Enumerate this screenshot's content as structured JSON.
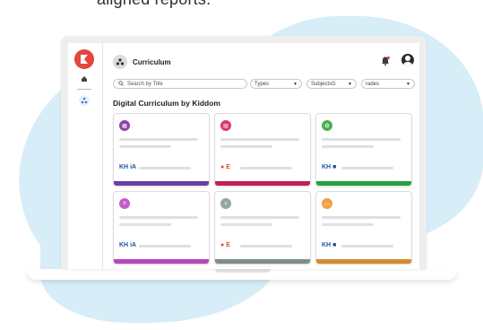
{
  "marketing": {
    "top_text": "aligned reports."
  },
  "app": {
    "header_title": "Curriculum",
    "section_title": "Digital Curriculum by Kiddom"
  },
  "search": {
    "placeholder": "Search by Title"
  },
  "filters": [
    {
      "label": "Types"
    },
    {
      "label": "SubjectsG"
    },
    {
      "label": "rades"
    }
  ],
  "cards": [
    {
      "accent": "#6a3fa8",
      "icon_bg": "#8e44ad",
      "icon_name": "calculator-icon",
      "brand": "KH",
      "brand_mark": "iA",
      "brand_color": "#1f4fa3"
    },
    {
      "accent": "#c0205a",
      "icon_bg": "#d63a6b",
      "icon_name": "book-icon",
      "brand": "●",
      "brand_mark": "E",
      "brand_color": "#e0472b"
    },
    {
      "accent": "#27a043",
      "icon_bg": "#4caf50",
      "icon_name": "science-icon",
      "brand": "KH",
      "brand_mark": "■",
      "brand_color": "#1f4fa3"
    },
    {
      "accent": "#b646b9",
      "icon_bg": "#c65bc8",
      "icon_name": "math-icon",
      "brand": "KH",
      "brand_mark": "iA",
      "brand_color": "#1f4fa3"
    },
    {
      "accent": "#7f8c8d",
      "icon_bg": "#95a5a6",
      "icon_name": "atom-icon",
      "brand": "●",
      "brand_mark": "E",
      "brand_color": "#e0472b"
    },
    {
      "accent": "#d68a2e",
      "icon_bg": "#f0a040",
      "icon_name": "computer-icon",
      "brand": "KH",
      "brand_mark": "■",
      "brand_color": "#1f4fa3"
    }
  ],
  "icons": {
    "logo": "kiddom-logo-icon",
    "home": "home-icon",
    "org": "organization-icon",
    "bell": "notification-bell-icon",
    "avatar": "user-avatar-icon",
    "search": "search-icon",
    "chevron": "chevron-down-icon"
  }
}
